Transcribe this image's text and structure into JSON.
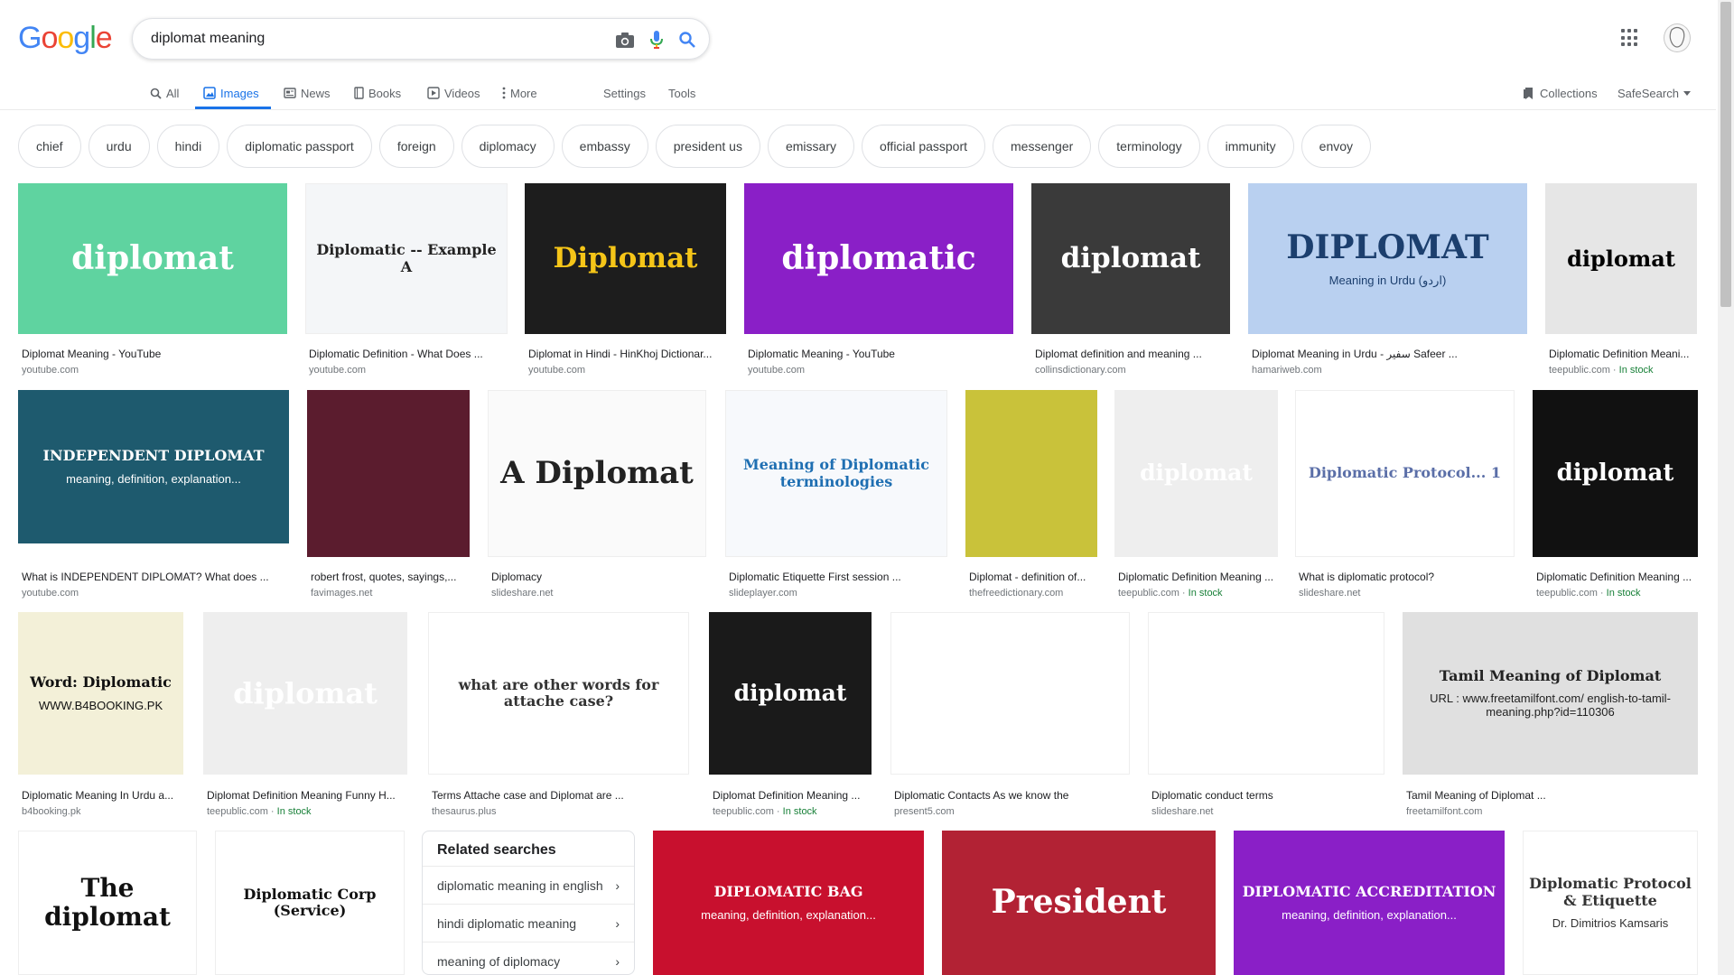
{
  "logo": [
    "G",
    "o",
    "o",
    "g",
    "l",
    "e"
  ],
  "search": {
    "query": "diplomat meaning"
  },
  "tabs": [
    {
      "label": "All"
    },
    {
      "label": "Images"
    },
    {
      "label": "News"
    },
    {
      "label": "Books"
    },
    {
      "label": "Videos"
    },
    {
      "label": "More"
    },
    {
      "label": "Settings"
    },
    {
      "label": "Tools"
    }
  ],
  "right_links": {
    "collections": "Collections",
    "safesearch": "SafeSearch"
  },
  "chips": [
    "chief",
    "urdu",
    "hindi",
    "diplomatic passport",
    "foreign",
    "diplomacy",
    "embassy",
    "president us",
    "emissary",
    "official passport",
    "messenger",
    "terminology",
    "immunity",
    "envoy"
  ],
  "results": [
    {
      "caption": "Diplomat Meaning - YouTube",
      "source": "youtube.com",
      "stock": "",
      "thumb_text": "diplomat",
      "bg": "#5fd3a0",
      "fg": "#ffffff"
    },
    {
      "caption": "Diplomatic Definition - What Does ...",
      "source": "youtube.com",
      "stock": "",
      "thumb_text": "Diplomatic -- Example A",
      "bg": "#f4f6f8",
      "fg": "#222222"
    },
    {
      "caption": "Diplomat in Hindi - HinKhoj Dictionar...",
      "source": "youtube.com",
      "stock": "",
      "thumb_text": "Diplomat",
      "bg": "#1d1d1d",
      "fg": "#f5c518"
    },
    {
      "caption": "Diplomatic Meaning - YouTube",
      "source": "youtube.com",
      "stock": "",
      "thumb_text": "diplomatic",
      "bg": "#8a1fc7",
      "fg": "#ffffff"
    },
    {
      "caption": "Diplomat definition and meaning ...",
      "source": "collinsdictionary.com",
      "stock": "",
      "thumb_text": "diplomat",
      "bg": "#3a3a3a",
      "fg": "#ffffff"
    },
    {
      "caption": "Diplomat Meaning in Urdu - سفیر Safeer ...",
      "source": "hamariweb.com",
      "stock": "",
      "thumb_text": "DIPLOMAT",
      "bg": "#b9d0f0",
      "fg": "#1c3f6e",
      "thumb_sub": "Meaning in Urdu (اردو)"
    },
    {
      "caption": "Diplomatic Definition Meani...",
      "source": "teepublic.com",
      "stock": "In stock",
      "thumb_text": "diplomat",
      "bg": "#e6e6e6",
      "fg": "#000000"
    },
    {
      "caption": "What is INDEPENDENT DIPLOMAT? What does ...",
      "source": "youtube.com",
      "stock": "",
      "thumb_text": "INDEPENDENT DIPLOMAT",
      "bg": "#1e5a6e",
      "fg": "#ffffff",
      "thumb_sub": "meaning, definition, explanation..."
    },
    {
      "caption": "robert frost, quotes, sayings,...",
      "source": "favimages.net",
      "stock": "",
      "thumb_text": "",
      "bg": "#5b1c2e",
      "fg": "#ffffff"
    },
    {
      "caption": "Diplomacy",
      "source": "slideshare.net",
      "stock": "",
      "thumb_text": "A Diplomat",
      "bg": "#fafafa",
      "fg": "#222222"
    },
    {
      "caption": "Diplomatic Etiquette First session ...",
      "source": "slideplayer.com",
      "stock": "",
      "thumb_text": "Meaning of Diplomatic terminologies",
      "bg": "#f7f9fc",
      "fg": "#1f6fb2"
    },
    {
      "caption": "Diplomat - definition of...",
      "source": "thefreedictionary.com",
      "stock": "",
      "thumb_text": "",
      "bg": "#c9c23a",
      "fg": "#000000"
    },
    {
      "caption": "Diplomatic Definition Meaning ...",
      "source": "teepublic.com",
      "stock": "In stock",
      "thumb_text": "diplomat",
      "bg": "#eeeeee",
      "fg": "#ffffff"
    },
    {
      "caption": "What is diplomatic protocol?",
      "source": "slideshare.net",
      "stock": "",
      "thumb_text": "Diplomatic Protocol... 1",
      "bg": "#ffffff",
      "fg": "#5b6fa8"
    },
    {
      "caption": "Diplomatic Definition Meaning ...",
      "source": "teepublic.com",
      "stock": "In stock",
      "thumb_text": "diplomat",
      "bg": "#111111",
      "fg": "#ffffff"
    },
    {
      "caption": "Diplomatic Meaning In Urdu a...",
      "source": "b4booking.pk",
      "stock": "",
      "thumb_text": "Word: Diplomatic",
      "bg": "#f3f0d8",
      "fg": "#111111",
      "thumb_sub": "WWW.B4BOOKING.PK"
    },
    {
      "caption": "Diplomat Definition Meaning Funny H...",
      "source": "teepublic.com",
      "stock": "In stock",
      "thumb_text": "diplomat",
      "bg": "#eeeeee",
      "fg": "#ffffff"
    },
    {
      "caption": "Terms Attache case and Diplomat are ...",
      "source": "thesaurus.plus",
      "stock": "",
      "thumb_text": "what are other words for attache case?",
      "bg": "#ffffff",
      "fg": "#333333"
    },
    {
      "caption": "Diplomat Definition Meaning ...",
      "source": "teepublic.com",
      "stock": "In stock",
      "thumb_text": "diplomat",
      "bg": "#1a1a1a",
      "fg": "#ffffff"
    },
    {
      "caption": "Diplomatic Contacts As we know the",
      "source": "present5.com",
      "stock": "",
      "thumb_text": "",
      "bg": "#ffffff",
      "fg": "#1f6fb2"
    },
    {
      "caption": "Diplomatic conduct terms",
      "source": "slideshare.net",
      "stock": "",
      "thumb_text": "",
      "bg": "#ffffff",
      "fg": "#333333"
    },
    {
      "caption": "Tamil Meaning of Diplomat ...",
      "source": "freetamilfont.com",
      "stock": "",
      "thumb_text": "Tamil Meaning of Diplomat",
      "bg": "#e0e0e0",
      "fg": "#222222",
      "thumb_sub": "URL : www.freetamilfont.com/ english-to-tamil-meaning.php?id=110306"
    },
    {
      "caption": "",
      "source": "",
      "stock": "",
      "thumb_text": "The diplomat",
      "bg": "#ffffff",
      "fg": "#111111"
    },
    {
      "caption": "",
      "source": "",
      "stock": "",
      "thumb_text": "Diplomatic Corp (Service)",
      "bg": "#ffffff",
      "fg": "#111111"
    },
    {
      "caption": "",
      "source": "",
      "stock": "",
      "thumb_text": "DIPLOMATIC BAG",
      "bg": "#c8102e",
      "fg": "#ffffff",
      "thumb_sub": "meaning, definition, explanation..."
    },
    {
      "caption": "",
      "source": "",
      "stock": "",
      "thumb_text": "President",
      "bg": "#b22234",
      "fg": "#ffffff"
    },
    {
      "caption": "",
      "source": "",
      "stock": "",
      "thumb_text": "DIPLOMATIC ACCREDITATION",
      "bg": "#8a1fc7",
      "fg": "#ffffff",
      "thumb_sub": "meaning, definition, explanation..."
    },
    {
      "caption": "",
      "source": "",
      "stock": "",
      "thumb_text": "Diplomatic Protocol & Etiquette",
      "bg": "#ffffff",
      "fg": "#333333",
      "thumb_sub": "Dr. Dimitrios Kamsaris"
    }
  ],
  "related": {
    "title": "Related searches",
    "items": [
      "diplomatic meaning in english",
      "hindi diplomatic meaning",
      "meaning of diplomacy"
    ]
  }
}
